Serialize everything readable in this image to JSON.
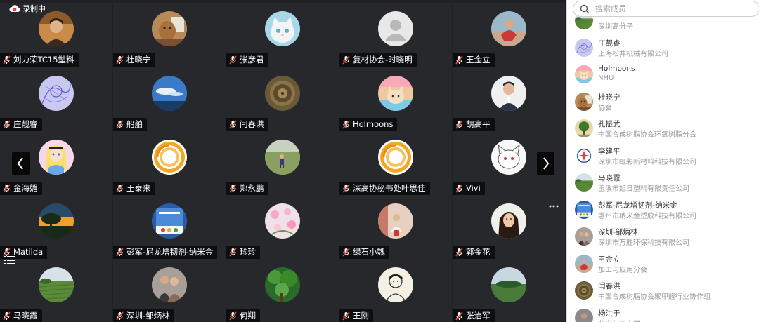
{
  "recording": {
    "label": "录制中"
  },
  "grid": {
    "tiles": [
      {
        "name": "刘力荣TC15塑料",
        "avatar": "portrait-man"
      },
      {
        "name": "杜晓宁",
        "avatar": "dog"
      },
      {
        "name": "张彦君",
        "avatar": "white-cat"
      },
      {
        "name": "复材协会-时晓明",
        "avatar": "default-person"
      },
      {
        "name": "王金立",
        "avatar": "person-red"
      },
      {
        "name": "庄靓睿",
        "avatar": "purple-sketch"
      },
      {
        "name": "船舶",
        "avatar": "blue-sky"
      },
      {
        "name": "闫春洪",
        "avatar": "bronze-disc"
      },
      {
        "name": "Holmoons",
        "avatar": "cartoon-cat"
      },
      {
        "name": "胡高平",
        "avatar": "man-suit"
      },
      {
        "name": "金海媚",
        "avatar": "alice"
      },
      {
        "name": "王泰来",
        "avatar": "orange-ring"
      },
      {
        "name": "郑永鹏",
        "avatar": "child-lawn"
      },
      {
        "name": "深高协秘书处叶思佳",
        "avatar": "orange-ring"
      },
      {
        "name": "Vivi",
        "avatar": "white-cartoon"
      },
      {
        "name": "Matilda",
        "avatar": "sunset-tree"
      },
      {
        "name": "彭军-尼龙增韧剂-纳米金",
        "avatar": "blue-poster"
      },
      {
        "name": "珍珍",
        "avatar": "pink-flowers"
      },
      {
        "name": "绿石小魏",
        "avatar": "girl-room"
      },
      {
        "name": "郭金花",
        "avatar": "woman"
      },
      {
        "name": "马晓霞",
        "avatar": "green-field"
      },
      {
        "name": "深圳-邹炳林",
        "avatar": "couple"
      },
      {
        "name": "何翔",
        "avatar": "forest"
      },
      {
        "name": "王刚",
        "avatar": "sketch-man"
      },
      {
        "name": "张治军",
        "avatar": "green-field-dark"
      }
    ]
  },
  "panel": {
    "search_placeholder": "搜索成员",
    "members": [
      {
        "name": "",
        "org": "深圳高分子",
        "avatar": "green-field"
      },
      {
        "name": "庄靓睿",
        "org": "上海松井机械有限公司",
        "avatar": "purple-sketch"
      },
      {
        "name": "Holmoons",
        "org": "NHU",
        "avatar": "cartoon-cat"
      },
      {
        "name": "杜晓宁",
        "org": "协会",
        "avatar": "dog"
      },
      {
        "name": "孔振武",
        "org": "中国合成树脂协会环氧树脂分会",
        "avatar": "tree-landscape"
      },
      {
        "name": "李建平",
        "org": "深圳市虹彩新材料科技有限公司",
        "avatar": "logo-circle"
      },
      {
        "name": "马晓霞",
        "org": "玉溪市旭日塑料有限责任公司",
        "avatar": "green-field"
      },
      {
        "name": "彭军-尼龙增韧剂-纳米金",
        "org": "惠州市纳米金塑胶科技有限公司",
        "avatar": "blue-poster"
      },
      {
        "name": "深圳-邹炳林",
        "org": "深圳市万胜环保科技有限公司",
        "avatar": "couple"
      },
      {
        "name": "王金立",
        "org": "加工与应用分会",
        "avatar": "person-red"
      },
      {
        "name": "闫春洪",
        "org": "中国合成树脂协会聚甲醛行业协作组",
        "avatar": "bronze-disc"
      },
      {
        "name": "杨洪于",
        "org": "北京化工大学",
        "avatar": "man-dark"
      }
    ]
  },
  "colors": {
    "grid_bg": "#1f2125",
    "tile_bg": "#26282c",
    "mic_muted": "#e8403b",
    "panel_bg": "#ffffff"
  }
}
